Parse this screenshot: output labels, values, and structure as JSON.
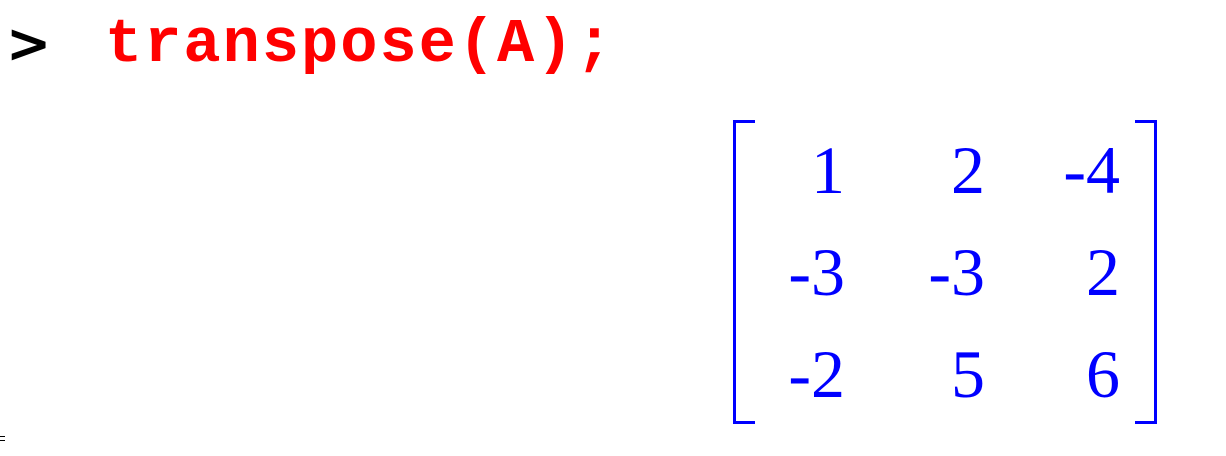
{
  "worksheet": {
    "prompt_symbol": ">",
    "command": "transpose(A);",
    "command_color": "#ff0000",
    "output_color": "#0000ff",
    "output_matrix": {
      "rows": [
        [
          "1",
          "2",
          "-4"
        ],
        [
          "-3",
          "-3",
          "2"
        ],
        [
          "-2",
          "5",
          "6"
        ]
      ]
    }
  }
}
